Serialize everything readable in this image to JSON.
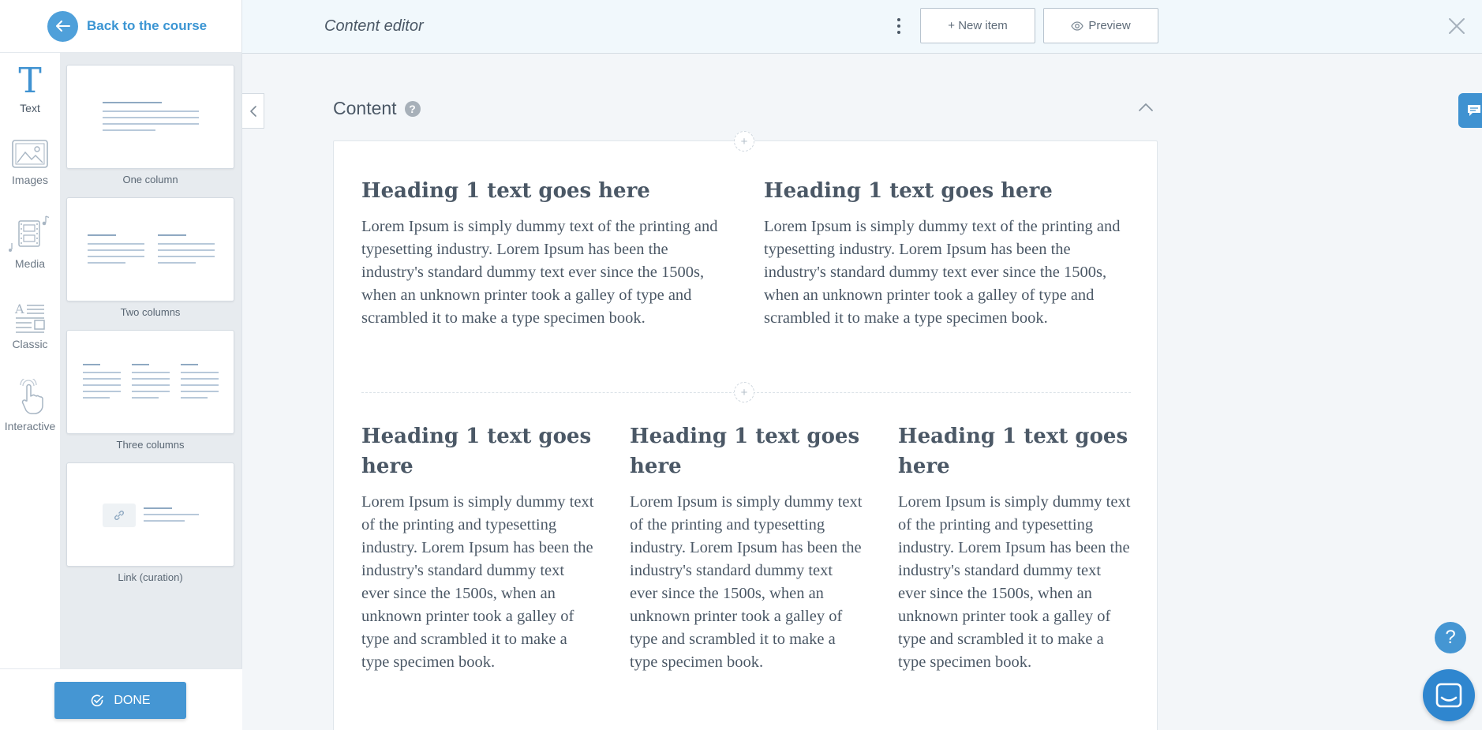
{
  "colors": {
    "accent": "#4596d3",
    "link": "#3b95d3",
    "text": "#4b5866",
    "panel_bg": "#e7ebef",
    "topbar_bg": "#f1f8fc"
  },
  "sidebar": {
    "back_label": "Back to the course",
    "categories": [
      {
        "label": "Text",
        "icon": "text-t-icon",
        "active": true
      },
      {
        "label": "Images",
        "icon": "image-icon"
      },
      {
        "label": "Media",
        "icon": "media-filmstrip-icon"
      },
      {
        "label": "Classic",
        "icon": "classic-layout-icon"
      },
      {
        "label": "Interactive",
        "icon": "pointer-hand-icon"
      }
    ],
    "blocks": [
      {
        "label": "One column"
      },
      {
        "label": "Two columns"
      },
      {
        "label": "Three columns"
      },
      {
        "label": "Link (curation)"
      }
    ],
    "done_label": "DONE"
  },
  "topbar": {
    "title": "Content editor",
    "new_item_label": "+ New item",
    "preview_label": "Preview"
  },
  "content": {
    "title": "Content",
    "help": "?",
    "add_symbol": "+",
    "rows": [
      {
        "columns": [
          {
            "heading": "Heading 1 text goes here",
            "body": "Lorem Ipsum is simply dummy text of the printing and typesetting industry. Lorem Ipsum has been the industry's standard dummy text ever since the 1500s, when an unknown printer took a galley of type and scrambled it to make a type specimen book."
          },
          {
            "heading": "Heading 1 text goes here",
            "body": "Lorem Ipsum is simply dummy text of the printing and typesetting industry. Lorem Ipsum has been the industry's standard dummy text ever since the 1500s, when an unknown printer took a galley of type and scrambled it to make a type specimen book."
          }
        ]
      },
      {
        "columns": [
          {
            "heading": "Heading 1 text goes here",
            "body": "Lorem Ipsum is simply dummy text of the printing and typesetting industry. Lorem Ipsum has been the industry's standard dummy text ever since the 1500s, when an unknown printer took a galley of type and scrambled it to make a type specimen book."
          },
          {
            "heading": "Heading 1 text goes here",
            "body": "Lorem Ipsum is simply dummy text of the printing and typesetting industry. Lorem Ipsum has been the industry's standard dummy text ever since the 1500s, when an unknown printer took a galley of type and scrambled it to make a type specimen book."
          },
          {
            "heading": "Heading 1 text goes here",
            "body": "Lorem Ipsum is simply dummy text of the printing and typesetting industry. Lorem Ipsum has been the industry's standard dummy text ever since the 1500s, when an unknown printer took a galley of type and scrambled it to make a type specimen book."
          }
        ]
      }
    ]
  },
  "floating": {
    "help_symbol": "?"
  }
}
